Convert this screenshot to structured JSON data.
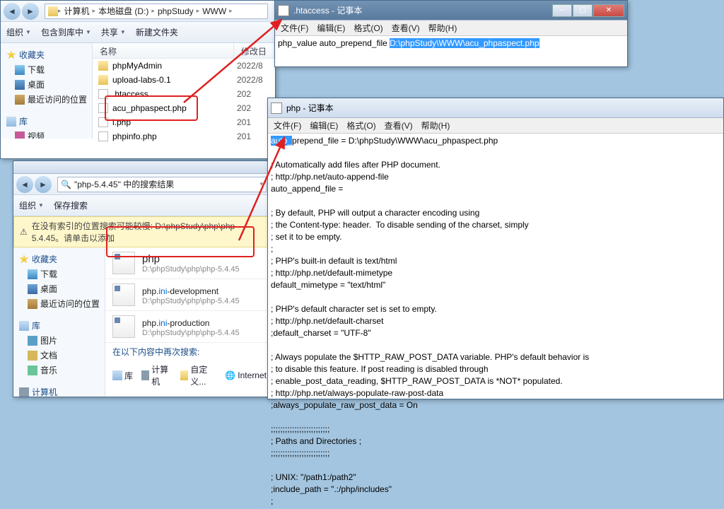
{
  "explorer1": {
    "path": [
      "计算机",
      "本地磁盘 (D:)",
      "phpStudy",
      "WWW"
    ],
    "toolbar": {
      "org": "组织",
      "inc": "包含到库中",
      "share": "共享",
      "new": "新建文件夹"
    },
    "cols": {
      "name": "名称",
      "date": "修改日"
    },
    "files": [
      {
        "name": "phpMyAdmin",
        "date": "2022/8",
        "type": "fld"
      },
      {
        "name": "upload-labs-0.1",
        "date": "2022/8",
        "type": "fld"
      },
      {
        "name": ".htaccess",
        "date": "202",
        "type": "file"
      },
      {
        "name": "acu_phpaspect.php",
        "date": "202",
        "type": "file"
      },
      {
        "name": "l.php",
        "date": "201",
        "type": "file"
      },
      {
        "name": "phpinfo.php",
        "date": "201",
        "type": "file"
      }
    ]
  },
  "sidebar": {
    "fav": "收藏夹",
    "dl": "下载",
    "desk": "桌面",
    "recent": "最近访问的位置",
    "lib": "库",
    "vid": "视频",
    "pic": "图片",
    "doc": "文档",
    "mus": "音乐",
    "pc": "计算机"
  },
  "explorer2": {
    "breadcrumb": "\"php-5.4.45\" 中的搜索结果",
    "toolbar": {
      "org": "组织",
      "save": "保存搜索"
    },
    "warn": "在没有索引的位置搜索可能较慢: D:\\phpStudy\\php\\php-5.4.45。请单击以添加",
    "results": [
      {
        "name": "php",
        "path": "D:\\phpStudy\\php\\php-5.4.45"
      },
      {
        "name_pre": "php.",
        "name_hl": "ini",
        "name_post": "-development",
        "path": "D:\\phpStudy\\php\\php-5.4.45"
      },
      {
        "name_pre": "php.",
        "name_hl": "ini",
        "name_post": "-production",
        "path": "D:\\phpStudy\\php\\php-5.4.45"
      }
    ],
    "again": "在以下内容中再次搜索:",
    "again_items": [
      "库",
      "计算机",
      "自定义...",
      "Internet"
    ]
  },
  "notepad1": {
    "title": ".htaccess - 记事本",
    "menu": {
      "file": "文件(F)",
      "edit": "编辑(E)",
      "fmt": "格式(O)",
      "view": "查看(V)",
      "help": "帮助(H)"
    },
    "line_pre": "php_value auto_prepend_file ",
    "line_sel": "D:\\phpStudy\\WWW\\acu_phpaspect.php"
  },
  "notepad2": {
    "title": "php - 记事本",
    "menu": {
      "file": "文件(F)",
      "edit": "编辑(E)",
      "fmt": "格式(O)",
      "view": "查看(V)",
      "help": "帮助(H)"
    },
    "sel": "auto_",
    "rest": "prepend_file = D:\\phpStudy\\WWW\\acu_phpaspect.php\n\n; Automatically add files after PHP document.\n; http://php.net/auto-append-file\nauto_append_file =\n\n; By default, PHP will output a character encoding using\n; the Content-type: header.  To disable sending of the charset, simply\n; set it to be empty.\n;\n; PHP's built-in default is text/html\n; http://php.net/default-mimetype\ndefault_mimetype = \"text/html\"\n\n; PHP's default character set is set to empty.\n; http://php.net/default-charset\n;default_charset = \"UTF-8\"\n\n; Always populate the $HTTP_RAW_POST_DATA variable. PHP's default behavior is\n; to disable this feature. If post reading is disabled through\n; enable_post_data_reading, $HTTP_RAW_POST_DATA is *NOT* populated.\n; http://php.net/always-populate-raw-post-data\n;always_populate_raw_post_data = On\n\n;;;;;;;;;;;;;;;;;;;;;;;;;\n; Paths and Directories ;\n;;;;;;;;;;;;;;;;;;;;;;;;;\n\n; UNIX: \"/path1:/path2\"\n;include_path = \".:/php/includes\"\n;"
  }
}
